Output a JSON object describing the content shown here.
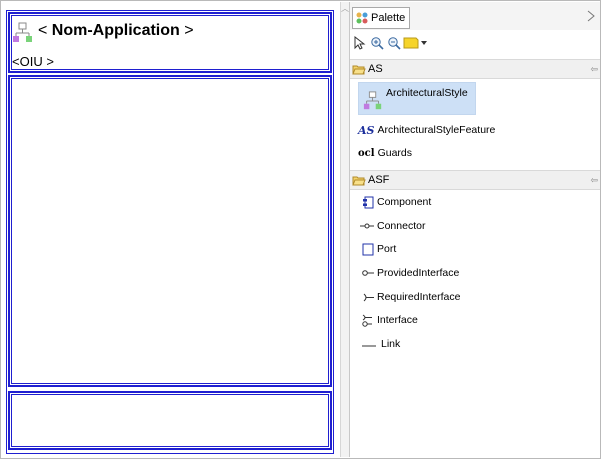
{
  "diagram": {
    "app_title_prefix": "< ",
    "app_title_name": "Nom-Application",
    "app_title_suffix": " >",
    "oiu_label": "<OIU >",
    "icon": "hierarchy-icon"
  },
  "palette": {
    "tab_label": "Palette",
    "tools": [
      "select-arrow-icon",
      "zoom-in-icon",
      "zoom-out-icon",
      "note-icon",
      "dropdown-arrow-icon"
    ],
    "drawers": [
      {
        "label": "AS",
        "items": [
          {
            "label": "ArchitecturalStyle",
            "icon": "hierarchy-icon",
            "selected": true
          },
          {
            "label": "ArchitecturalStyleFeature",
            "icon_text": "AS"
          },
          {
            "label": "Guards",
            "icon_text": "ocl"
          }
        ]
      },
      {
        "label": "ASF",
        "items": [
          {
            "label": "Component",
            "icon": "component-icon"
          },
          {
            "label": "Connector",
            "icon": "connector-icon"
          },
          {
            "label": "Port",
            "icon": "port-icon"
          },
          {
            "label": "ProvidedInterface",
            "icon": "provided-interface-icon"
          },
          {
            "label": "RequiredInterface",
            "icon": "required-interface-icon"
          },
          {
            "label": "Interface",
            "icon": "interface-icon"
          },
          {
            "label": "Link",
            "icon": "link-icon"
          }
        ]
      }
    ]
  },
  "colors": {
    "frame_blue": "#1f1fd0",
    "selection": "#cde0f6"
  }
}
